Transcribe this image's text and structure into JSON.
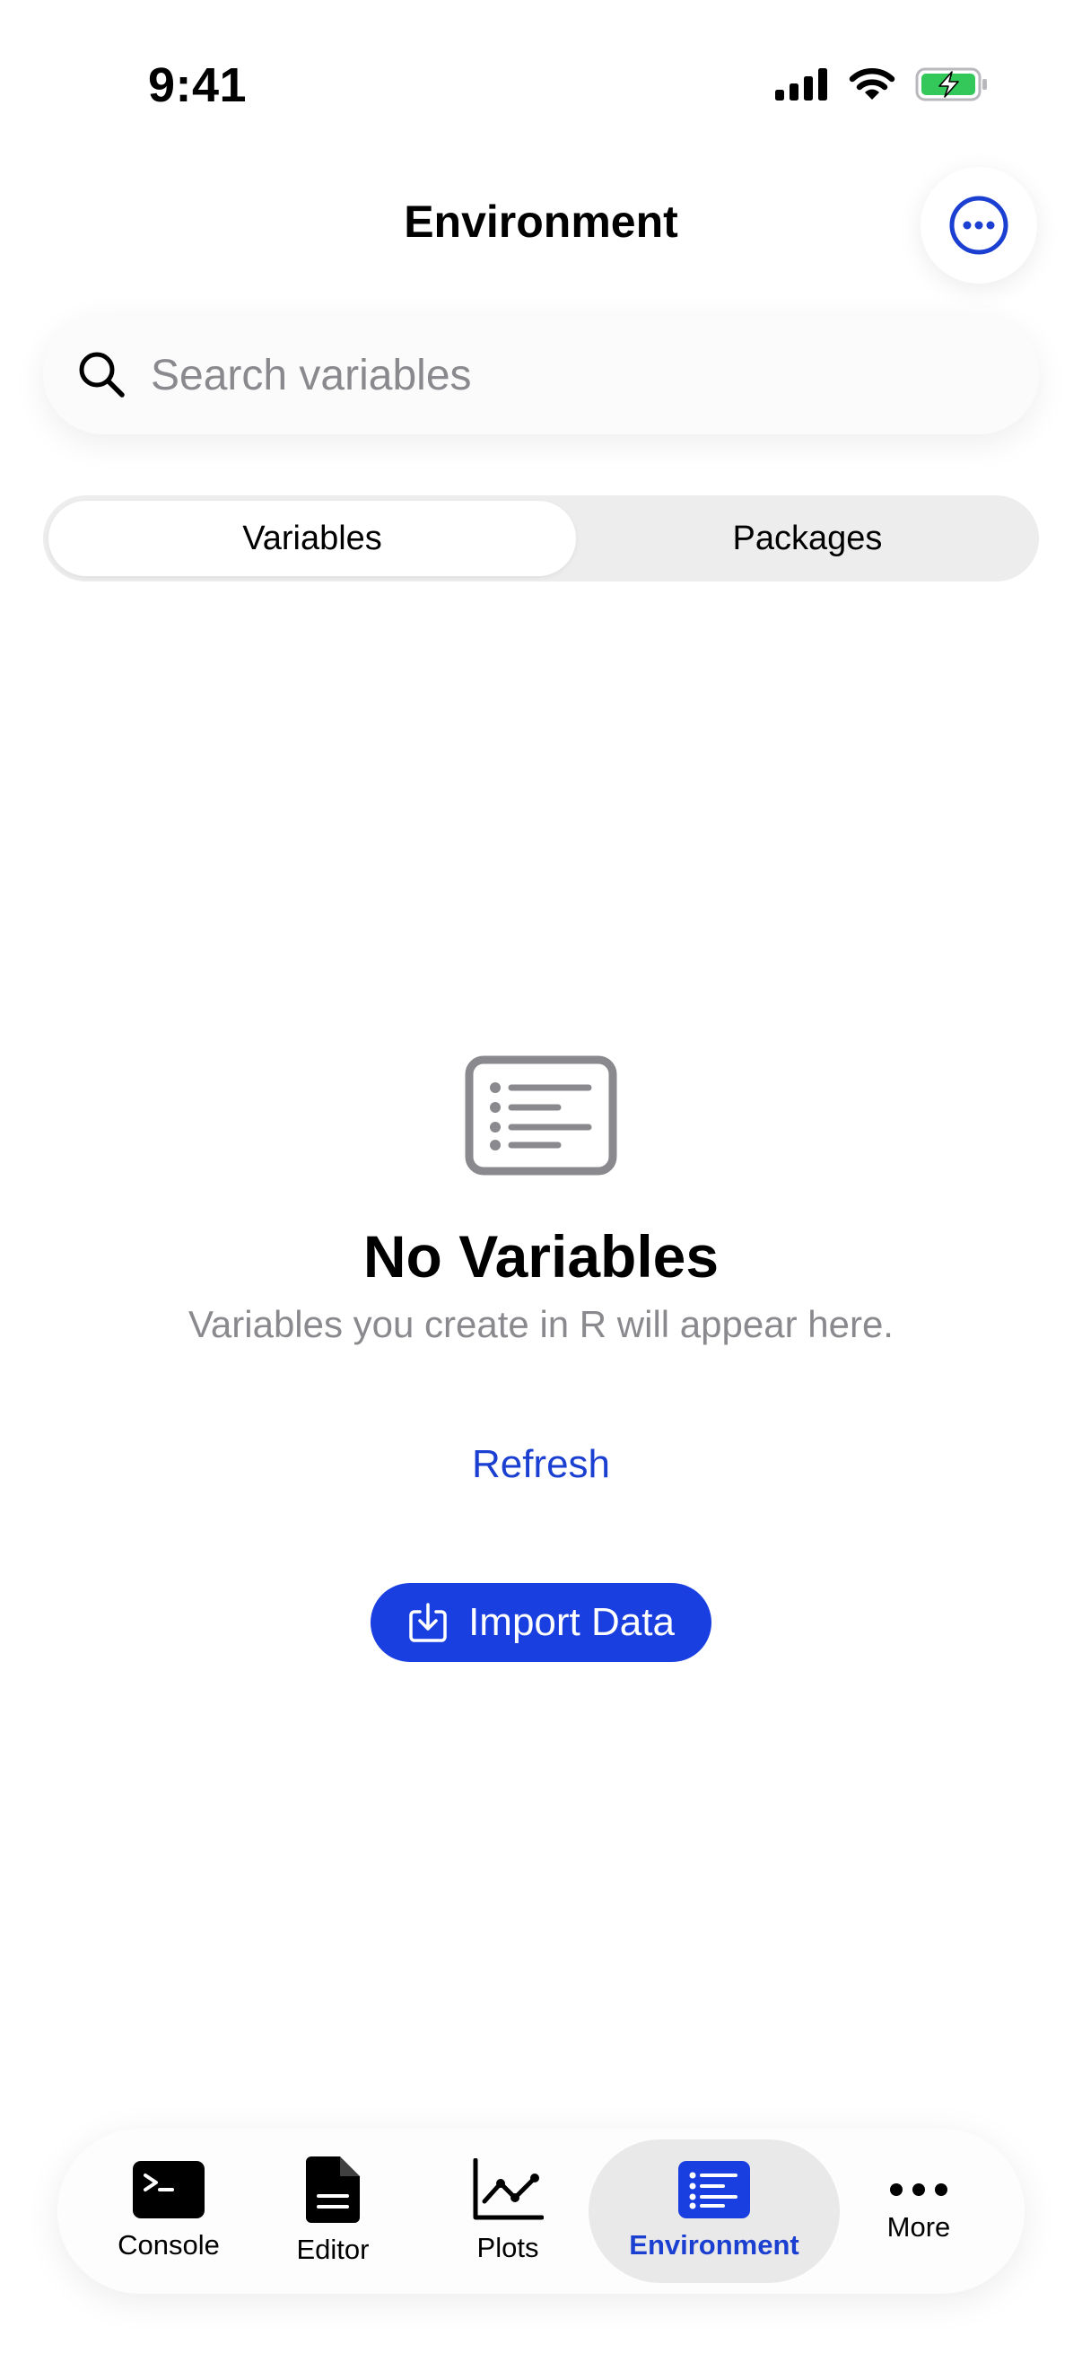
{
  "status_bar": {
    "time": "9:41"
  },
  "header": {
    "title": "Environment",
    "more_icon": "ellipsis-circle-icon"
  },
  "search": {
    "placeholder": "Search variables",
    "value": ""
  },
  "segments": {
    "active": "Variables",
    "inactive": "Packages"
  },
  "empty_state": {
    "icon": "list-icon",
    "title": "No Variables",
    "subtitle": "Variables you create in R will appear here.",
    "refresh_label": "Refresh",
    "import_label": "Import Data"
  },
  "tabs": [
    {
      "label": "Console",
      "icon": "terminal-icon"
    },
    {
      "label": "Editor",
      "icon": "document-icon"
    },
    {
      "label": "Plots",
      "icon": "chart-line-icon"
    },
    {
      "label": "Environment",
      "icon": "list-icon",
      "selected": true
    },
    {
      "label": "More",
      "icon": "ellipsis-icon"
    }
  ],
  "colors": {
    "accent": "#1a3fd1",
    "button_fill": "#1a3fe0",
    "battery_green": "#34c759",
    "muted_text": "#8a8a8e"
  }
}
